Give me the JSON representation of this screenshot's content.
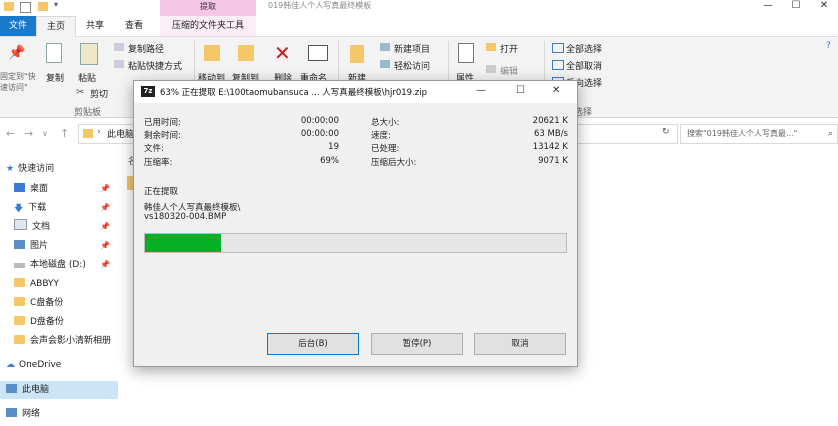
{
  "titlebar": {
    "extract_tab": "提取",
    "window_title": "019韩佳人个人写真最终模板",
    "minimize": "—",
    "maximize": "☐",
    "close": "✕"
  },
  "tabs": {
    "file": "文件",
    "home": "主页",
    "share": "共享",
    "view": "查看",
    "compressed_tools": "压缩的文件夹工具"
  },
  "ribbon": {
    "pin_quick": "固定到\"快\n速访问\"",
    "copy": "复制",
    "paste": "粘贴",
    "copy_path": "复制路径",
    "paste_shortcut": "粘贴快捷方式",
    "cut": "剪切",
    "clipboard_group": "剪贴板",
    "move_to": "移动到",
    "copy_to": "复制到",
    "delete": "删除",
    "rename": "重命名",
    "new_folder": "新建",
    "new_item": "新建项目",
    "easy_access": "轻松访问",
    "properties": "属性",
    "open": "打开",
    "edit": "编辑",
    "select_all": "全部选择",
    "select_none": "全部取消",
    "invert_selection": "反向选择",
    "select_group": "选择"
  },
  "address": {
    "path_part": "此电脑",
    "search_placeholder": "搜索\"019韩佳人个人写真最...\""
  },
  "nav": {
    "quick_access": "快速访问",
    "items": [
      {
        "label": "桌面"
      },
      {
        "label": "下载"
      },
      {
        "label": "文档"
      },
      {
        "label": "图片"
      },
      {
        "label": "本地磁盘 (D:)"
      },
      {
        "label": "ABBYY"
      },
      {
        "label": "C盘备份"
      },
      {
        "label": "D盘备份"
      },
      {
        "label": "会声会影小清新相册"
      }
    ],
    "onedrive": "OneDrive",
    "this_pc": "此电脑",
    "network": "网络"
  },
  "dialog": {
    "title": "63% 正在提取 E:\\100taomubansuca ... 人写真最终模板\\hjr019.zip",
    "icon_text": "7z",
    "left": [
      {
        "label": "已用时间:",
        "value": "00:00:00"
      },
      {
        "label": "剩余时间:",
        "value": "00:00:00"
      },
      {
        "label": "文件:",
        "value": "19"
      },
      {
        "label": "压缩率:",
        "value": "69%"
      }
    ],
    "right": [
      {
        "label": "总大小:",
        "value": "20621 K"
      },
      {
        "label": "速度:",
        "value": "63 MB/s"
      },
      {
        "label": "已处理:",
        "value": "13142 K"
      },
      {
        "label": "压缩后大小:",
        "value": "9071 K"
      }
    ],
    "status": "正在提取",
    "current_folder": "韩佳人个人写真最终模板\\",
    "current_file": "vs180320-004.BMP",
    "progress": 0.18,
    "background_button": "后台(B)",
    "pause_button": "暂停(P)",
    "cancel_button": "取消",
    "minimize": "—",
    "maximize": "☐",
    "close": "✕"
  },
  "colors": {
    "file_tab": "#1979ca",
    "extract_tab": "#f6c6e6",
    "progress": "#06b025"
  }
}
